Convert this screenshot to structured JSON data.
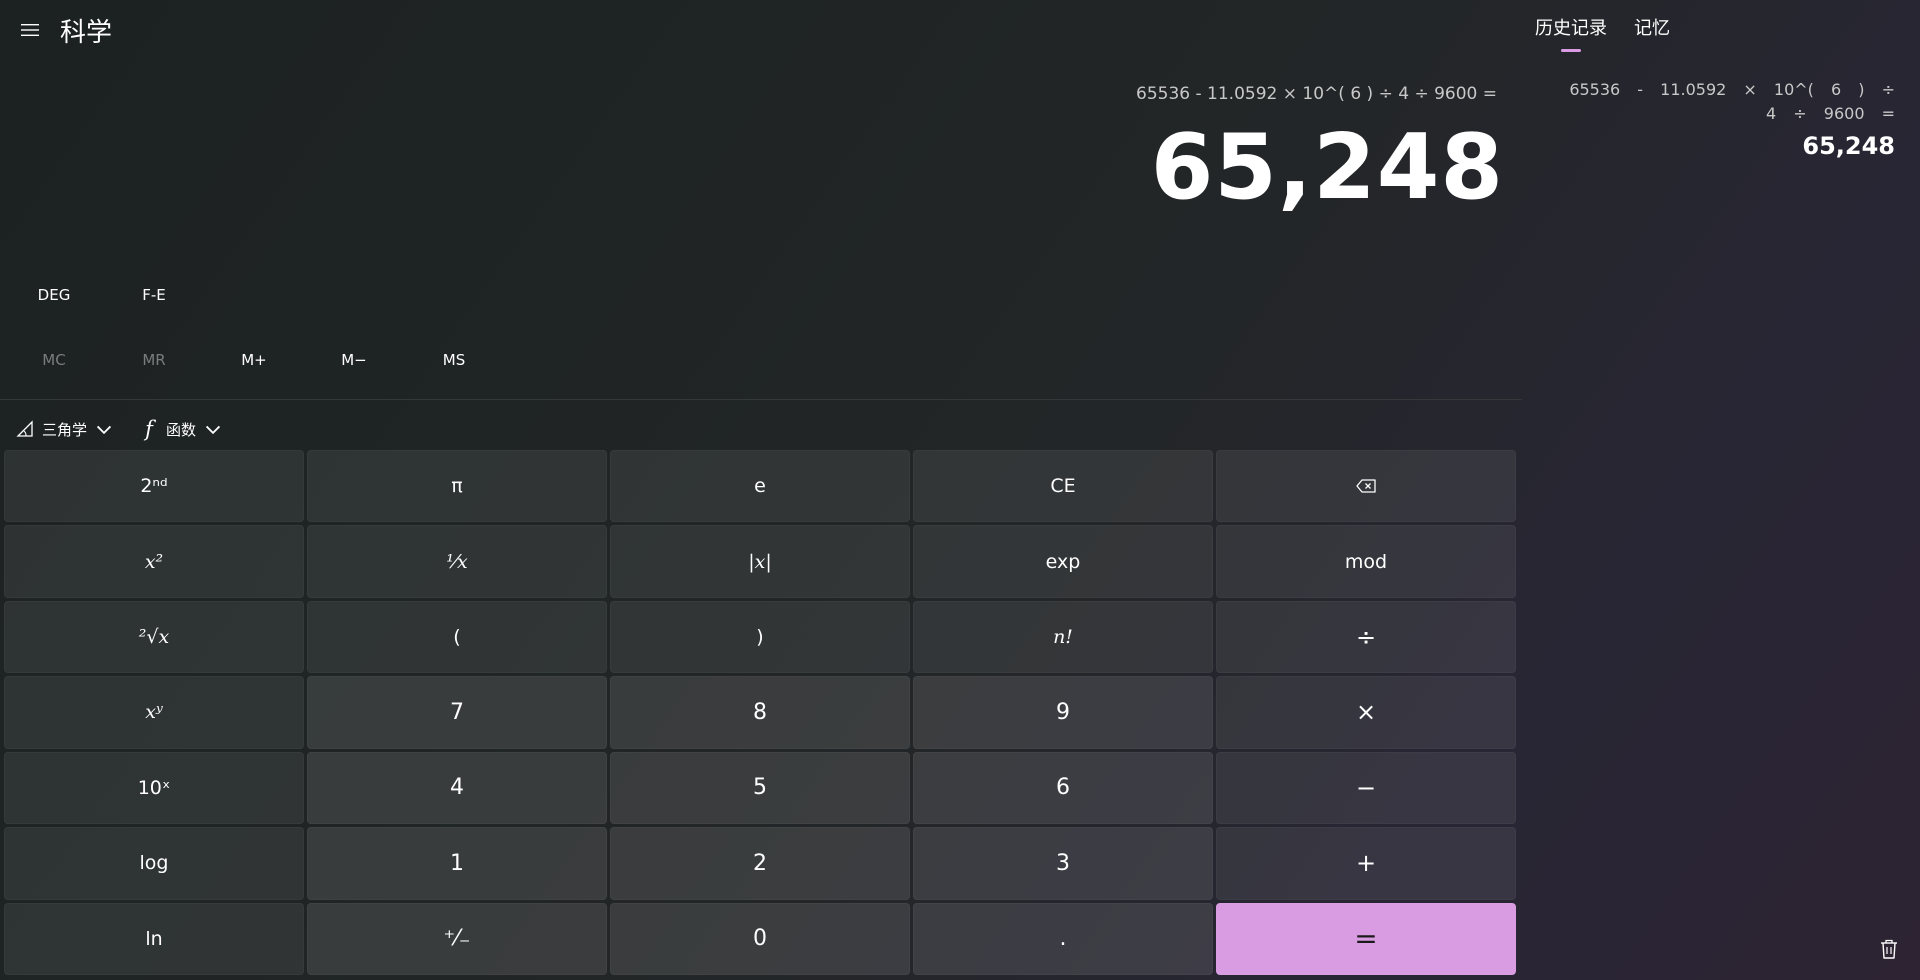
{
  "header": {
    "title": "科学",
    "menu_icon": "hamburger-icon"
  },
  "display": {
    "expression": "65536 - 11.0592 × 10^( 6 ) ÷ 4 ÷ 9600 =",
    "result": "65,248"
  },
  "toggles": {
    "angle": "DEG",
    "fe": "F-E"
  },
  "memory": {
    "mc": "MC",
    "mr": "MR",
    "mplus": "M+",
    "mminus": "M−",
    "ms": "MS"
  },
  "dropdowns": {
    "trig": "三角学",
    "func": "函数"
  },
  "keys": {
    "second": "2ⁿᵈ",
    "pi": "π",
    "e": "e",
    "ce": "CE",
    "sq": "x²",
    "inv": "¹⁄x",
    "abs": "|x|",
    "exp": "exp",
    "mod": "mod",
    "sqrt": "²√x",
    "lparen": "(",
    "rparen": ")",
    "fact": "n!",
    "div": "÷",
    "pow": "xʸ",
    "d7": "7",
    "d8": "8",
    "d9": "9",
    "mul": "×",
    "tenx": "10ˣ",
    "d4": "4",
    "d5": "5",
    "d6": "6",
    "sub": "−",
    "log": "log",
    "d1": "1",
    "d2": "2",
    "d3": "3",
    "add": "+",
    "ln": "ln",
    "negate": "⁺⁄₋",
    "d0": "0",
    "dot": ".",
    "equals": "="
  },
  "panel": {
    "tab_history": "历史记录",
    "tab_memory": "记忆",
    "history_expression": "65536 - 11.0592 × 10^( 6 ) ÷ 4 ÷ 9600 =",
    "history_result": "65,248"
  },
  "colors": {
    "accent": "#d99ce2"
  }
}
